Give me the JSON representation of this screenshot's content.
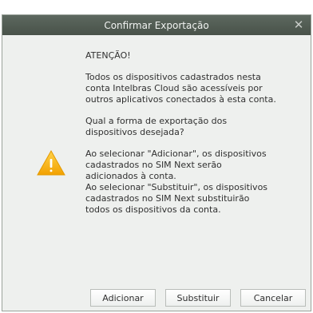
{
  "dialog": {
    "title": "Confirmar Exportação",
    "close_glyph": "✕",
    "icon": "warning-icon",
    "heading": "ATENÇÃO!",
    "paragraph1": [
      "Todos os dispositivos cadastrados nesta",
      "conta Intelbras Cloud são acessíveis por",
      "outros aplicativos conectados à esta conta."
    ],
    "question": [
      "Qual a forma de exportação dos",
      "dispositivos desejada?"
    ],
    "paragraph3": [
      "Ao selecionar \"Adicionar\", os dispositivos",
      "cadastrados no SIM Next serão",
      "adicionados à conta.",
      "Ao selecionar \"Substituir\", os dispositivos",
      "cadastrados no SIM Next substituirão",
      "todos os dispositivos da conta."
    ],
    "buttons": {
      "add": "Adicionar",
      "replace": "Substituir",
      "cancel": "Cancelar"
    }
  }
}
